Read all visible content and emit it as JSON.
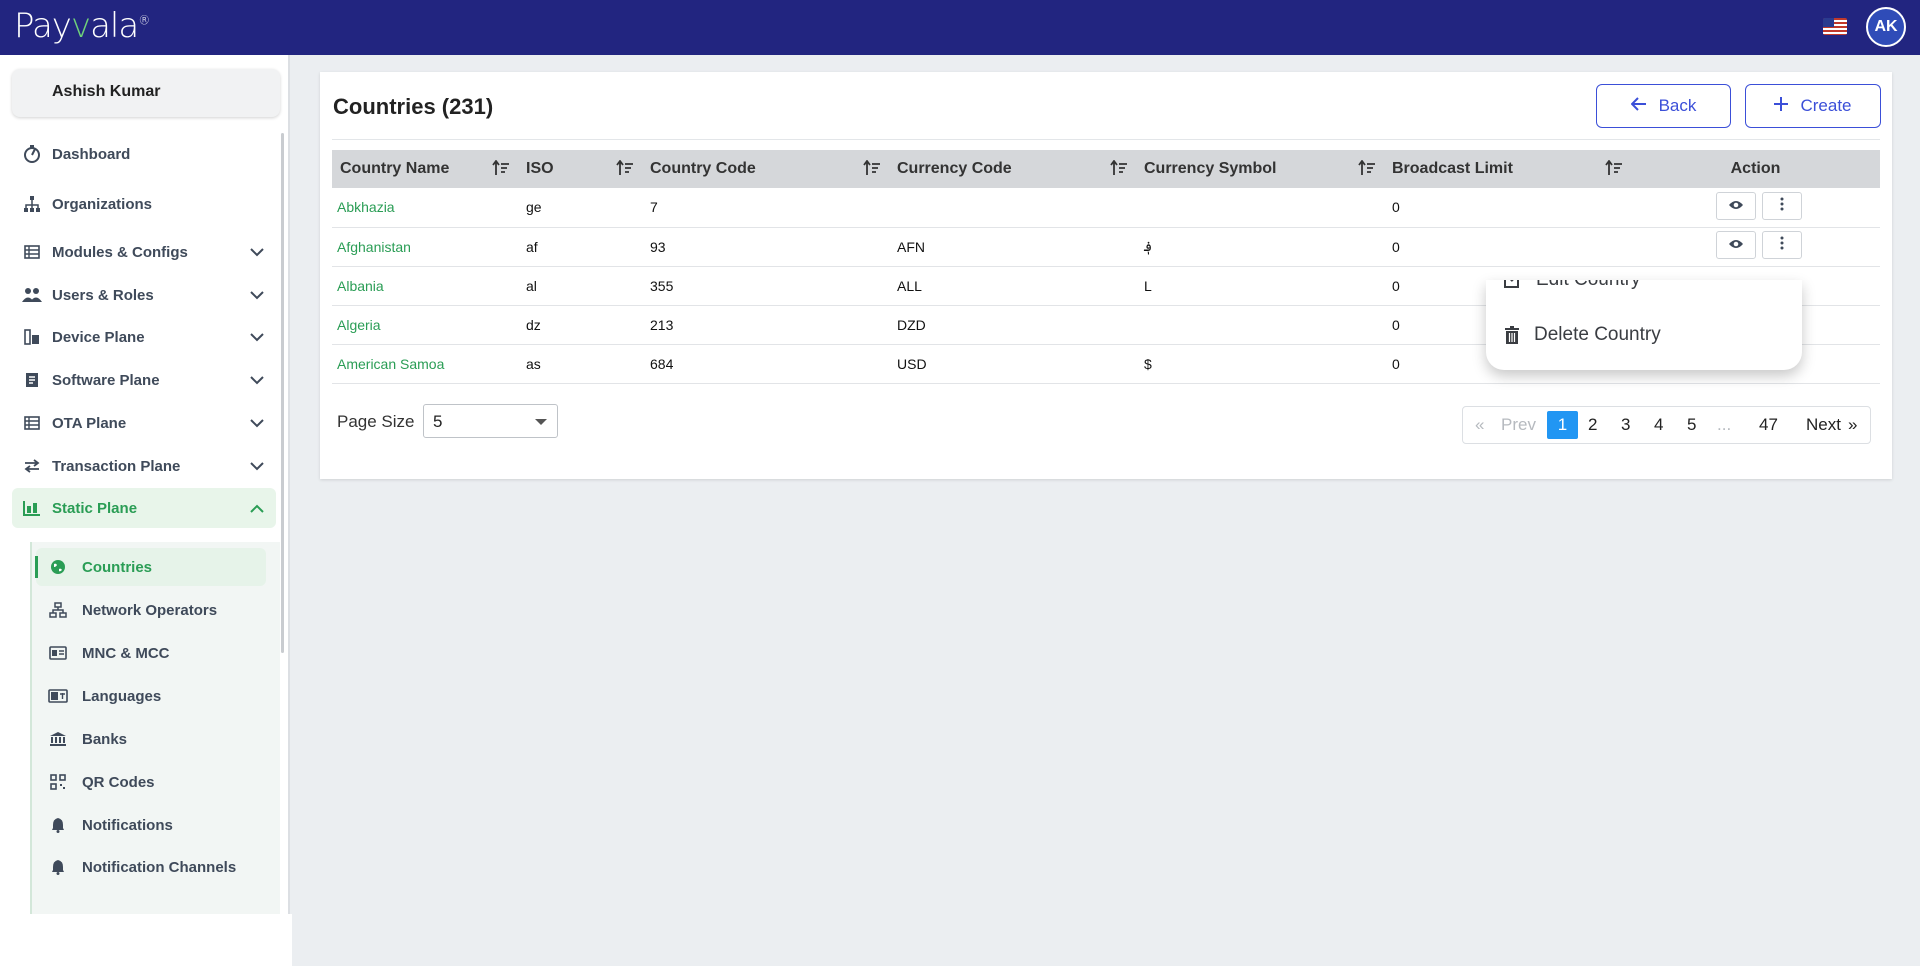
{
  "brand": {
    "logo_text_a": "Pay",
    "logo_text_v": "v",
    "logo_text_b": "ala",
    "registered": "®"
  },
  "header": {
    "avatar_initials": "AK"
  },
  "user": {
    "name": "Ashish Kumar"
  },
  "sidebar": {
    "items": [
      {
        "label": "Dashboard",
        "icon": "dashboard-icon"
      },
      {
        "label": "Organizations",
        "icon": "org-icon"
      },
      {
        "label": "Modules & Configs",
        "icon": "table-icon"
      },
      {
        "label": "Users & Roles",
        "icon": "users-icon"
      },
      {
        "label": "Device Plane",
        "icon": "device-icon"
      },
      {
        "label": "Software Plane",
        "icon": "software-icon"
      },
      {
        "label": "OTA Plane",
        "icon": "table-icon"
      },
      {
        "label": "Transaction Plane",
        "icon": "transfer-icon"
      },
      {
        "label": "Static Plane",
        "icon": "static-icon"
      }
    ],
    "sub_items": [
      {
        "label": "Countries",
        "icon": "globe-icon"
      },
      {
        "label": "Network Operators",
        "icon": "network-icon"
      },
      {
        "label": "MNC & MCC",
        "icon": "id-card-icon"
      },
      {
        "label": "Languages",
        "icon": "language-icon"
      },
      {
        "label": "Banks",
        "icon": "bank-icon"
      },
      {
        "label": "QR Codes",
        "icon": "qr-icon"
      },
      {
        "label": "Notifications",
        "icon": "bell-icon"
      },
      {
        "label": "Notification Channels",
        "icon": "bell-icon"
      }
    ]
  },
  "page": {
    "title": "Countries (231)",
    "back_label": "Back",
    "create_label": "Create"
  },
  "table": {
    "columns": [
      "Country Name",
      "ISO",
      "Country Code",
      "Currency Code",
      "Currency Symbol",
      "Broadcast Limit",
      "Action"
    ],
    "rows": [
      {
        "name": "Abkhazia",
        "iso": "ge",
        "code": "7",
        "currency": "",
        "symbol": "",
        "limit": "0"
      },
      {
        "name": "Afghanistan",
        "iso": "af",
        "code": "93",
        "currency": "AFN",
        "symbol": "؋",
        "limit": "0"
      },
      {
        "name": "Albania",
        "iso": "al",
        "code": "355",
        "currency": "ALL",
        "symbol": "L",
        "limit": "0"
      },
      {
        "name": "Algeria",
        "iso": "dz",
        "code": "213",
        "currency": "DZD",
        "symbol": "",
        "limit": "0"
      },
      {
        "name": "American Samoa",
        "iso": "as",
        "code": "684",
        "currency": "USD",
        "symbol": "$",
        "limit": "0"
      }
    ]
  },
  "pagination": {
    "page_size_label": "Page Size",
    "page_size": "5",
    "first": "«",
    "prev": "Prev",
    "pages": [
      "1",
      "2",
      "3",
      "4",
      "5"
    ],
    "ellipsis": "...",
    "last_page": "47",
    "next": "Next",
    "last": "»",
    "current": "1"
  },
  "context_menu": {
    "edit_label": "Edit Country",
    "delete_label": "Delete Country"
  },
  "colors": {
    "header": "#222580",
    "accent": "#2a9d55",
    "primary": "#3b4fd8",
    "active_page": "#2196f3"
  }
}
